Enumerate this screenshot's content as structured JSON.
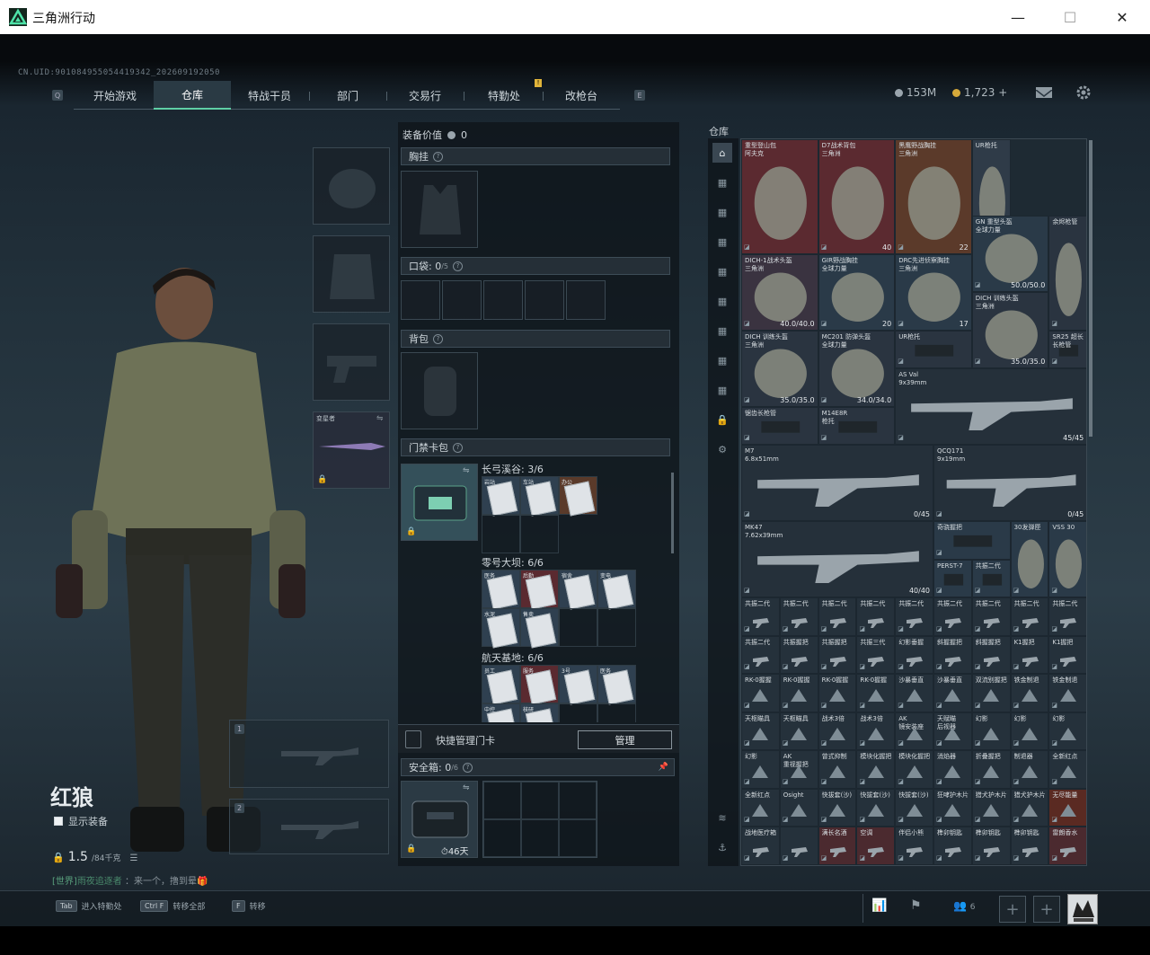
{
  "window": {
    "title": "三角洲行动",
    "minimize": "—",
    "maximize": "☐",
    "close": "✕"
  },
  "uid": "CN.UID:901084955054419342_202609192050",
  "nav": {
    "left_key": "Q",
    "right_key": "E",
    "tabs": [
      "开始游戏",
      "仓库",
      "特战干员",
      "部门",
      "交易行",
      "特勤处",
      "改枪台"
    ],
    "active": "仓库",
    "notice_badge": "!"
  },
  "currency": {
    "silver": "153M",
    "gold": "1,723",
    "gold_plus": "+"
  },
  "operator": {
    "name": "红狼",
    "show_gear": "显示装备",
    "weight": "1.5",
    "weight_max": "/84千克",
    "chat_channel": "[世界]",
    "chat_user": "雨夜追逐者",
    "chat_msg": "来一个，撸到晕🎁"
  },
  "equip_slots": [
    {
      "name": "helmet"
    },
    {
      "name": "armor"
    },
    {
      "name": "pistol"
    },
    {
      "name": "melee",
      "label": "变星者"
    }
  ],
  "weapon_slots": [
    "1",
    "2"
  ],
  "loadout": {
    "value_label": "装备价值",
    "value": "0",
    "chest": "胸挂",
    "pocket": "口袋:",
    "pocket_count": "0",
    "pocket_max": "/5",
    "backpack": "背包",
    "keycard": "门禁卡包",
    "maps": [
      {
        "name": "长弓溪谷:",
        "count": "3/6",
        "cards": [
          "岩站",
          "车站",
          "办公"
        ]
      },
      {
        "name": "零号大坝:",
        "count": "6/6",
        "cards": [
          "医务",
          "后勤",
          "宿舍",
          "变电",
          "水泥",
          "售卖"
        ]
      },
      {
        "name": "航天基地:",
        "count": "6/6",
        "cards": [
          "员工",
          "服务",
          "3号",
          "医务",
          "中控",
          "核研"
        ]
      }
    ],
    "quick_manage": "快捷管理门卡",
    "manage_btn": "管理",
    "safebox": "安全箱:",
    "safebox_count": "0",
    "safebox_max": "/6",
    "safebox_days": "46天"
  },
  "storage": {
    "title": "仓库",
    "items": [
      {
        "label": "重型登山包\n阿夫克",
        "bg": "#5b2a30",
        "val": ""
      },
      {
        "label": "D7战术背包\n三角洲",
        "bg": "#5b2a30",
        "val": "40"
      },
      {
        "label": "黑鹰野战胸挂\n三角洲",
        "bg": "#5b3a2a",
        "val": "22"
      },
      {
        "label": "UR枪托",
        "bg": "#2f3b48",
        "val": ""
      },
      {
        "label": "GN 重型头盔\n全球力量",
        "bg": "#2a3a48",
        "val": "50.0/50.0"
      },
      {
        "label": "余烬枪管",
        "bg": "#2a3440",
        "val": ""
      },
      {
        "label": "DICH-1战术头盔\n三角洲",
        "bg": "#3a3340",
        "val": "40.0/40.0"
      },
      {
        "label": "GIR野战胸挂\n全球力量",
        "bg": "#2a3a48",
        "val": "20"
      },
      {
        "label": "DRC先进侦察胸挂\n三角洲",
        "bg": "#2a3a48",
        "val": "17"
      },
      {
        "label": "DICH 训练头盔\n三角洲",
        "bg": "#2a3440",
        "val": "35.0/35.0"
      },
      {
        "label": "SR25 超长\n长枪管",
        "bg": "#2a3440",
        "val": ""
      },
      {
        "label": "DICH 训练头盔\n三角洲",
        "bg": "#2a3440",
        "val": "35.0/35.0"
      },
      {
        "label": "MC201 防弹头盔\n全球力量",
        "bg": "#2a3440",
        "val": "34.0/34.0"
      },
      {
        "label": "UR枪托",
        "bg": "#2a3440",
        "val": ""
      },
      {
        "label": "AS Val\n9x39mm",
        "bg": "#25303a",
        "val": "45/45"
      },
      {
        "label": "锯齿长枪管",
        "bg": "#2a3440",
        "val": ""
      },
      {
        "label": "M14E8R\n枪托",
        "bg": "#2a3440",
        "val": ""
      },
      {
        "label": "M7\n6.8x51mm",
        "bg": "#25303a",
        "val": "0/45"
      },
      {
        "label": "QCQ171\n9x19mm",
        "bg": "#25303a",
        "val": "0/45"
      },
      {
        "label": "MK47\n7.62x39mm",
        "bg": "#25303a",
        "val": "40/40"
      },
      {
        "label": "奇骁握把",
        "bg": "#2a3a48",
        "val": ""
      },
      {
        "label": "30发弹匣",
        "bg": "#2a3a48",
        "val": ""
      },
      {
        "label": "VSS 30",
        "bg": "#2a3a48",
        "val": ""
      },
      {
        "label": "PERST-7",
        "bg": "#2a3a48",
        "val": ""
      },
      {
        "label": "共振二代",
        "bg": "#2a3a48",
        "val": ""
      }
    ],
    "small_rows": [
      [
        "共振二代",
        "共振二代",
        "共振二代",
        "共振二代",
        "共振二代",
        "共振二代",
        "共振二代",
        "共振二代",
        "共振二代"
      ],
      [
        "共振二代",
        "共振握把",
        "共振握把",
        "共振三代",
        "幻影垂握",
        "斜握握把",
        "斜握握把",
        "K1握把",
        "K1握把"
      ],
      [
        "RK-0握握",
        "RK-0握握",
        "RK-0握握",
        "RK-0握握",
        "沙暴垂直",
        "沙暴垂直",
        "双流别握把",
        "铁金制退",
        "铁金制退"
      ],
      [
        "天枢瞄具",
        "天枢瞄具",
        "战术3倍",
        "战术3倍",
        "AK\n镜安装座",
        "天赋瞄\n后视器",
        "幻影",
        "幻影",
        "幻影"
      ],
      [
        "幻影",
        "AK\n重视握把",
        "曾式抑制",
        "模块化握把",
        "模块化握把",
        "消焰器",
        "折叠握把",
        "制退器",
        "全新红点"
      ],
      [
        "全新红点",
        "Osight",
        "快拔套(沙)",
        "快拔套(沙)",
        "快拔套(沙)",
        "狂哮护木片",
        "猎犬护木片",
        "猎犬护木片",
        "无尽能量"
      ],
      [
        "战地医疗箱",
        "",
        "满长名酒",
        "空调",
        "伴侣小熊",
        "榫卯钥匙",
        "榫卯钥匙",
        "榫卯钥匙",
        "雷朗香水"
      ]
    ]
  },
  "bottom": {
    "keys": [
      {
        "k": "Tab",
        "t": "进入特勤处"
      },
      {
        "k": "Ctrl F",
        "t": "转移全部"
      },
      {
        "k": "F",
        "t": "转移"
      }
    ],
    "friends": "6"
  }
}
